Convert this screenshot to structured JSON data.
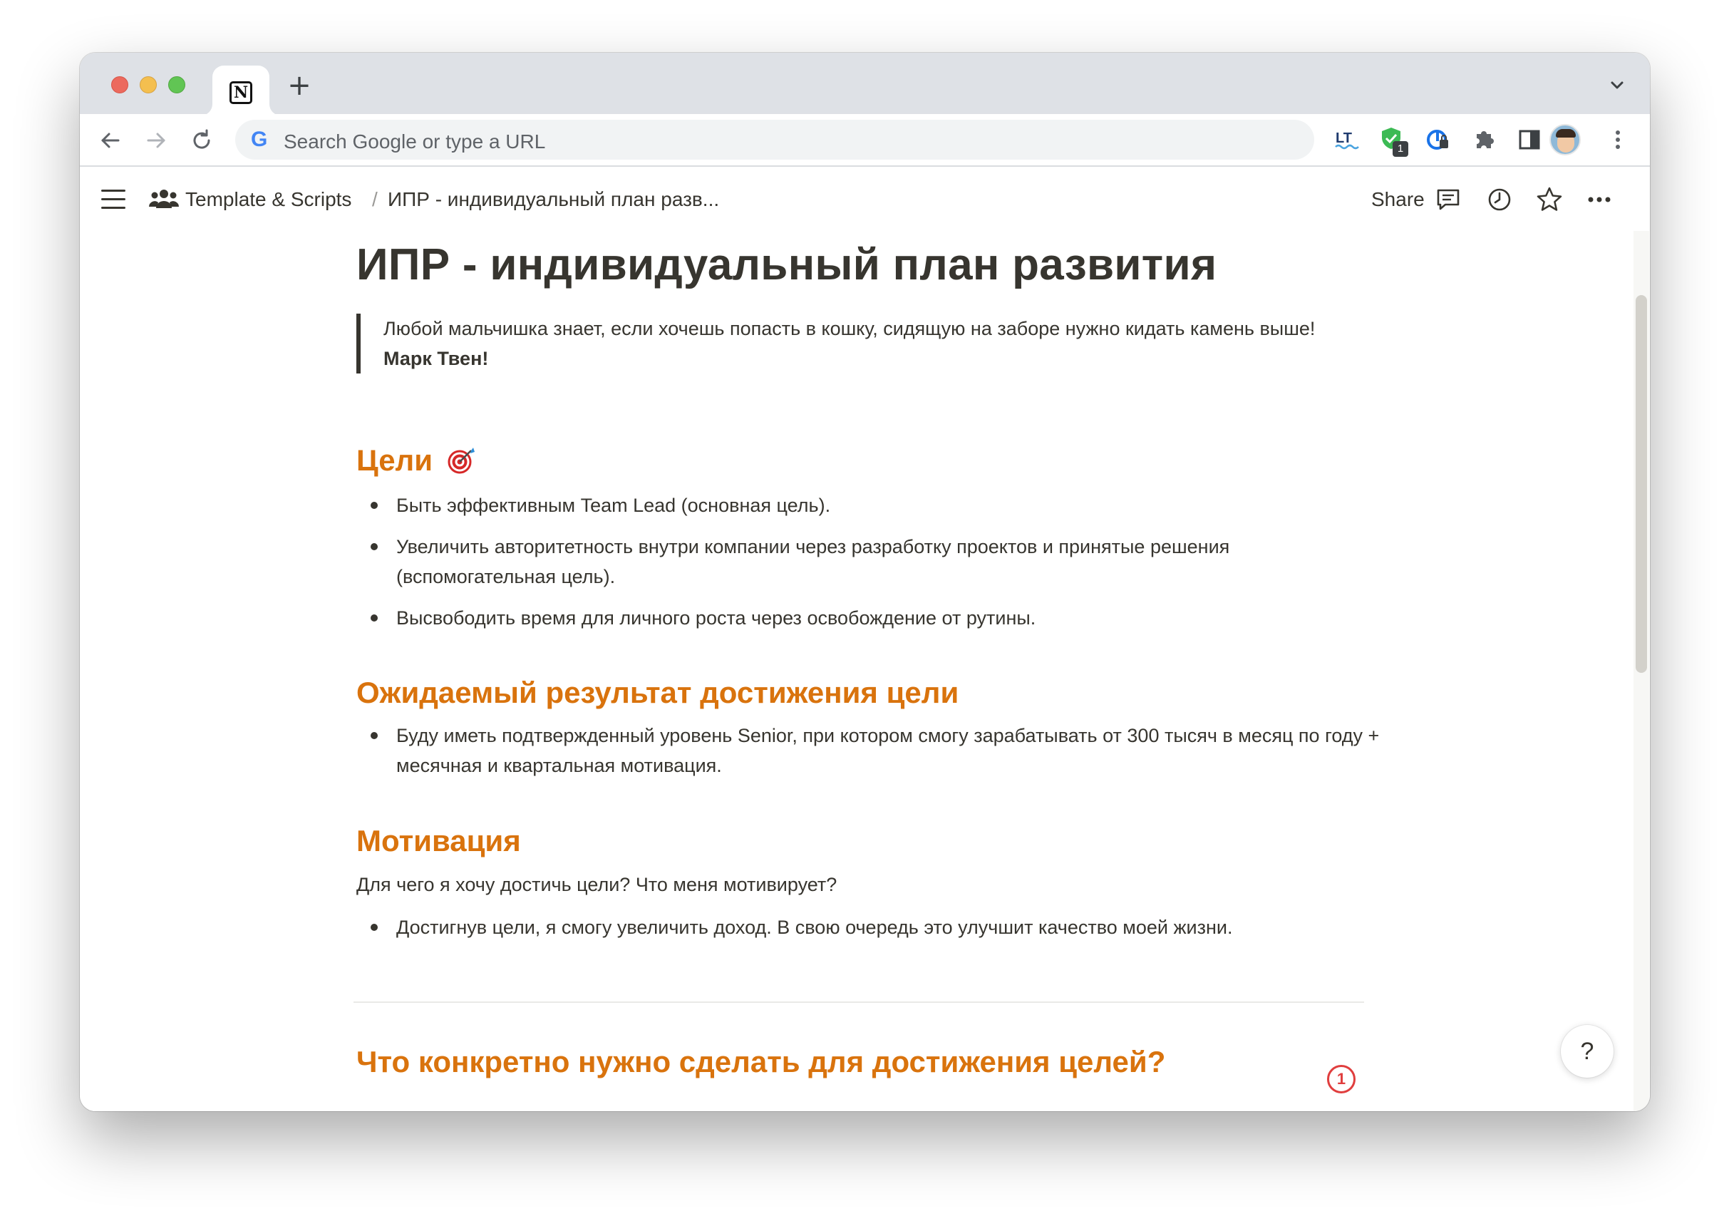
{
  "browser": {
    "tab_favicon": "notion-logo",
    "new_tab_symbol": "+",
    "omnibox_placeholder": "Search Google or type a URL",
    "google_letter": "G",
    "extension_badge": "1",
    "toolbar_icons": [
      "back-arrow-icon",
      "forward-arrow-icon",
      "reload-icon",
      "languagetool-icon",
      "shield-extension-icon",
      "password-extension-icon",
      "puzzle-icon",
      "sidepanel-icon",
      "avatar",
      "kebab-menu-icon"
    ]
  },
  "header": {
    "workspace": "Template & Scripts",
    "separator": "/",
    "page_crumb": "ИПР - индивидуальный план разв...",
    "share_label": "Share"
  },
  "page": {
    "title": "ИПР - индивидуальный план развития",
    "quote": {
      "text": "Любой мальчишка знает, если хочешь попасть в кошку, сидящую на заборе нужно кидать камень выше!",
      "author": "Марк Твен!"
    },
    "sections": {
      "goals": {
        "heading": "Цели",
        "emoji": "🎯",
        "items": [
          "Быть эффективным Team Lead (основная цель).",
          "Увеличить авторитетность внутри компании через разработку проектов и принятые решения (вспомогательная цель).",
          "Высвободить время для личного роста через освобождение от рутины."
        ]
      },
      "expected": {
        "heading": "Ожидаемый результат достижения цели",
        "items": [
          "Буду иметь подтвержденный уровень Senior, при котором смогу зарабатывать от 300 тысяч в месяц по году + месячная и квартальная мотивация."
        ]
      },
      "motivation": {
        "heading": "Мотивация",
        "question": "Для чего я хочу достичь цели? Что меня мотивирует?",
        "items": [
          "Достигнув цели, я смогу увеличить доход. В свою очередь это улучшит качество моей жизни."
        ]
      },
      "todo": {
        "heading": "Что конкретно нужно сделать для достижения целей?"
      }
    },
    "help_label": "?",
    "counter_badge": "1"
  },
  "colors": {
    "heading_orange": "#d9730d",
    "text": "#37352f",
    "badge_red": "#e03e3e"
  }
}
